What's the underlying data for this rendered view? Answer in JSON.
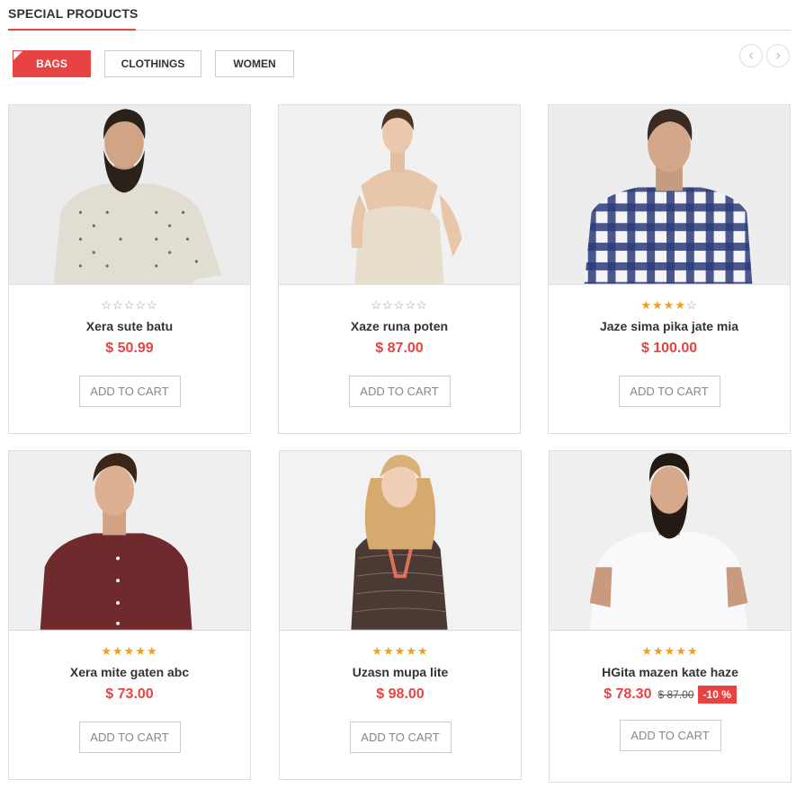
{
  "section": {
    "title": "SPECIAL PRODUCTS"
  },
  "tabs": [
    {
      "label": "BAGS",
      "active": true
    },
    {
      "label": "CLOTHINGS",
      "active": false
    },
    {
      "label": "WOMEN",
      "active": false
    }
  ],
  "nav": {
    "prev_icon": "chevron-left-icon",
    "next_icon": "chevron-right-icon",
    "prev": "‹",
    "next": "›"
  },
  "colors": {
    "accent": "#e84343",
    "star_on": "#f0a020",
    "star_off": "#999999"
  },
  "products": [
    {
      "name": "Xera sute batu",
      "price": "$ 50.99",
      "rating": 0,
      "cart_label": "ADD TO CART"
    },
    {
      "name": "Xaze runa poten",
      "price": "$ 87.00",
      "rating": 0,
      "cart_label": "ADD TO CART"
    },
    {
      "name": "Jaze sima pika jate mia",
      "price": "$ 100.00",
      "rating": 4,
      "cart_label": "ADD TO CART"
    },
    {
      "name": "Xera mite gaten abc",
      "price": "$ 73.00",
      "rating": 5,
      "cart_label": "ADD TO CART"
    },
    {
      "name": "Uzasn mupa lite",
      "price": "$ 98.00",
      "rating": 5,
      "cart_label": "ADD TO CART"
    },
    {
      "name": "HGita mazen kate haze",
      "price": "$ 78.30",
      "old_price": "$ 87.00",
      "discount": "-10 %",
      "rating": 5,
      "cart_label": "ADD TO CART"
    }
  ]
}
